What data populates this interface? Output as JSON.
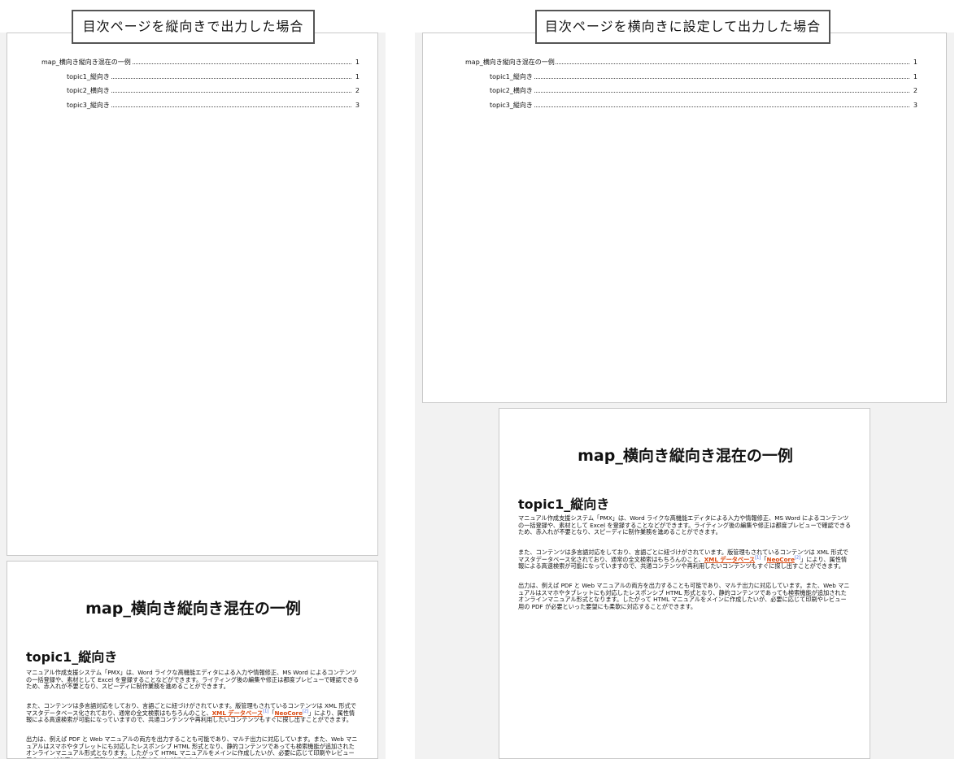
{
  "captions": {
    "left": "目次ページを縦向きで出力した場合",
    "right": "目次ページを横向きに設定して出力した場合"
  },
  "toc": [
    {
      "title": "map_横向き縦向き混在の一例",
      "page": "1",
      "level": 0
    },
    {
      "title": "topic1_縦向き",
      "page": "1",
      "level": 1
    },
    {
      "title": "topic2_横向き",
      "page": "2",
      "level": 1
    },
    {
      "title": "topic3_縦向き",
      "page": "3",
      "level": 1
    }
  ],
  "doc": {
    "title": "map_横向き縦向き混在の一例",
    "heading": "topic1_縦向き",
    "p1": "マニュアル作成支援システム「PMX」は、Word ライクな高機能エディタによる入力や情報修正、MS Word によるコンテンツの一括登録や、素材として Excel を登録することなどができます。ライティング後の編集や修正は都度プレビューで確認できるため、赤入れが不要となり、スピーディに制作業務を進めることができます。",
    "p2_a": "また、コンテンツは多言語対応をしており、言語ごとに紐づけがされています。版管理もされているコンテンツは XML 形式でマスタデータベース化されており、通常の全文検索はもちろんのこと、",
    "link1": "XML データベース",
    "sup1": "[1]",
    "p2_mid": "「",
    "link2": "NeoCore",
    "sup2": "[2]",
    "p2_b": "」により、属性情報による高速検索が可能になっていますので、共通コンテンツや再利用したいコンテンツもすぐに探し出すことができます。",
    "p3": "出力は、例えば PDF と Web マニュアルの両方を出力することも可能であり、マルチ出力に対応しています。また、Web マニュアルはスマホやタブレットにも対応したレスポンシブ HTML 形式となり、静的コンテンツであっても検索機能が追加されたオンラインマニュアル形式となります。したがって HTML マニュアルをメインに作成したいが、必要に応じて印刷やレビュー用の PDF が必要といった要望にも柔軟に対応することができます。"
  }
}
